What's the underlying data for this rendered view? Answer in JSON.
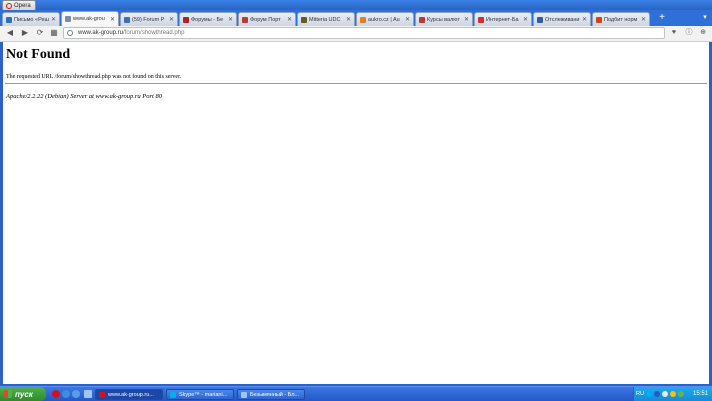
{
  "window": {
    "app_name": "Opera"
  },
  "tabs": [
    {
      "label": "Письмо «Реш",
      "favicon_color": "#2a6fc9",
      "active": false
    },
    {
      "label": "www.ak-grou",
      "favicon_color": "#7a8ca8",
      "active": true
    },
    {
      "label": "(59) Forum P",
      "favicon_color": "#3b6fb6",
      "active": false
    },
    {
      "label": "Форумы - Бе",
      "favicon_color": "#b32020",
      "active": false
    },
    {
      "label": "Форум Порт",
      "favicon_color": "#c0392b",
      "active": false
    },
    {
      "label": "Mitteria UDC",
      "favicon_color": "#6a5a2a",
      "active": false
    },
    {
      "label": "aukro.cz | Au",
      "favicon_color": "#e67e22",
      "active": false
    },
    {
      "label": "Курсы валют",
      "favicon_color": "#c0392b",
      "active": false
    },
    {
      "label": "Интернет-Ба",
      "favicon_color": "#d32f2f",
      "active": false
    },
    {
      "label": "Отслеживани",
      "favicon_color": "#2d5ea8",
      "active": false
    },
    {
      "label": "Подбит норм",
      "favicon_color": "#d84315",
      "active": false
    }
  ],
  "toolbar": {
    "back_icon": "back-arrow-icon",
    "forward_icon": "forward-arrow-icon",
    "reload_icon": "reload-icon",
    "home_icon": "speed-dial-icon",
    "address_host": "www.ak-group.ru",
    "address_path": "/forum/showthread.php"
  },
  "page": {
    "heading": "Not Found",
    "message": "The requested URL /forum/showthread.php was not found on this server.",
    "server_signature": "Apache/2.2.22 (Debian) Server at www.ak-group.ru Port 80"
  },
  "taskbar": {
    "start_label": "пуск",
    "tasks": [
      {
        "label": "www.ak-group.ru...",
        "favicon_color": "#d2111f",
        "active": true
      },
      {
        "label": "Skype™ - mariani...",
        "favicon_color": "#00aff0",
        "active": false
      },
      {
        "label": "Безымянный - Бл...",
        "favicon_color": "#9fc5f8",
        "active": false
      }
    ],
    "language": "RU",
    "clock": "15:51"
  }
}
